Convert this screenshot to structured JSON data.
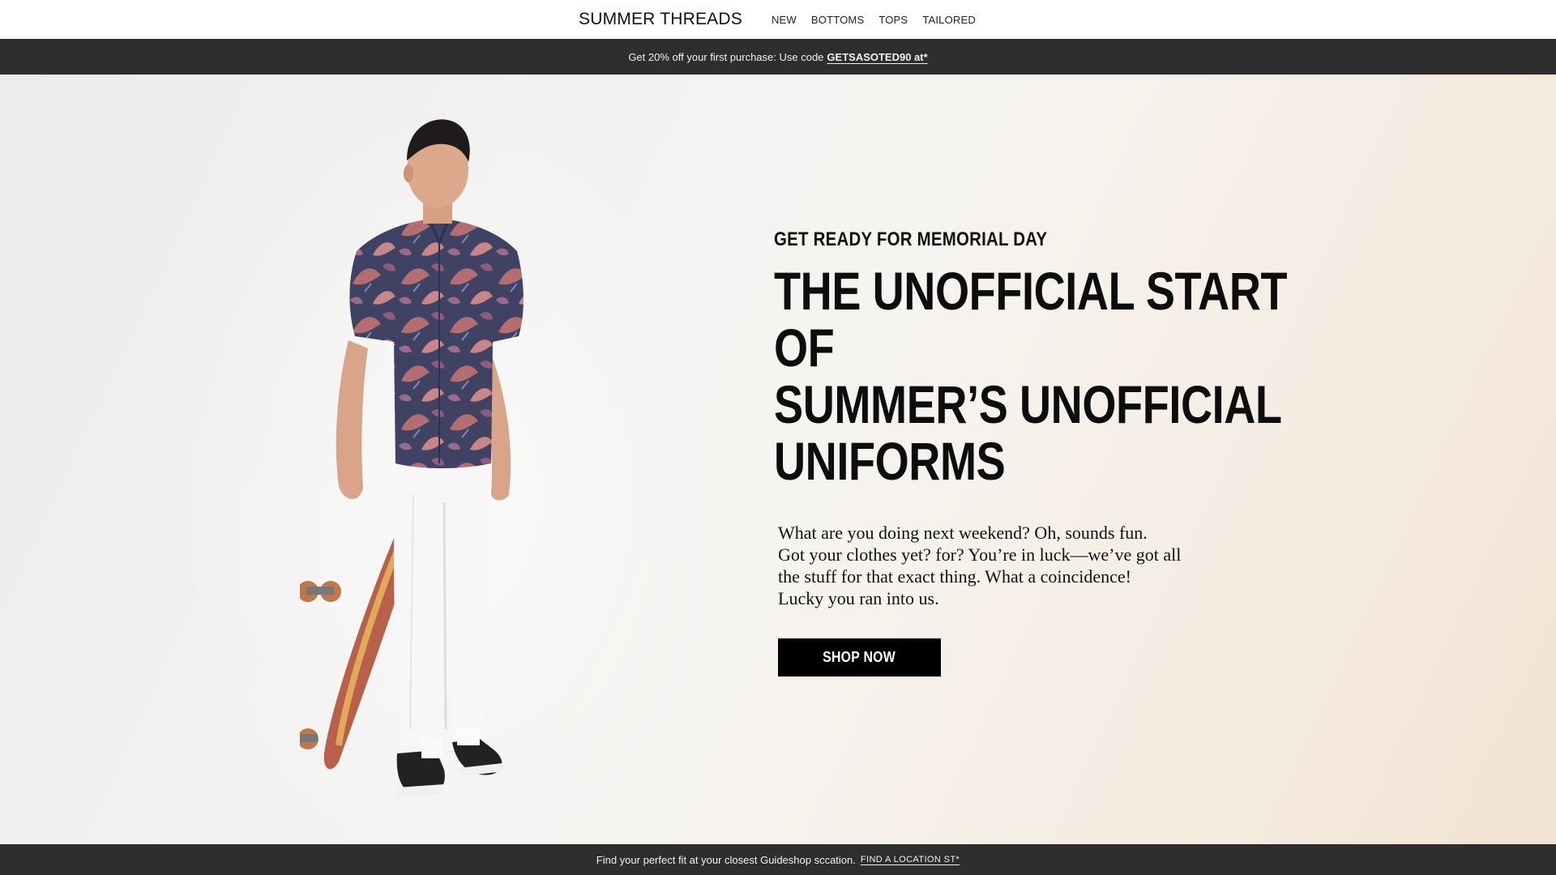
{
  "header": {
    "brand": "SUMMER THREADS",
    "nav": [
      {
        "label": "NEW"
      },
      {
        "label": "BOTTOMS"
      },
      {
        "label": "TOPS"
      },
      {
        "label": "TAILORED"
      }
    ]
  },
  "promo": {
    "text": "Get 20% off your first purchase: Use code",
    "code": "GETSASOTED90 at*"
  },
  "hero": {
    "eyebrow": "GET READY FOR MEMORIAL DAY",
    "headline_lines": [
      "THE UNOFFICIAL START OF",
      "SUMMER’S UNOFFICIAL",
      "UNIFORMS"
    ],
    "body_lines": [
      "What are you doing next weekend? Oh, sounds fun.",
      "Got your clothes yet? for? You’re in luck—we’ve got all",
      "the stuff for that exact thing. What a coincidence!",
      "Lucky you ran into us."
    ],
    "cta_label": "SHOP NOW"
  },
  "footer_bar": {
    "text": "Find your perfect fit at your closest Guideshop sccation.",
    "link_label": "FIND A LOCATION ST*"
  },
  "colors": {
    "bar_background": "#2e2e2e",
    "cta_background": "#000000",
    "shirt_base": "#3f4263",
    "shirt_print": "#b46e72"
  }
}
